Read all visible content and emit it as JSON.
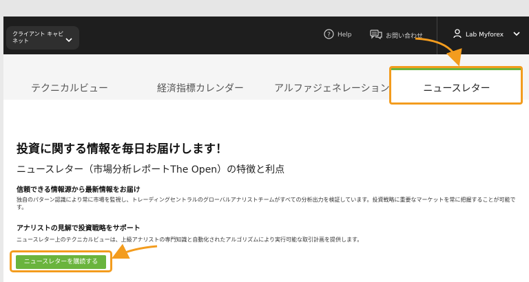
{
  "header": {
    "cabinet_label": "クライアント キャビネット",
    "help_label": "Help",
    "contact_label": "お問い合わせ",
    "user_label": "Lab Myforex"
  },
  "tabs": [
    {
      "label": "テクニカルビュー"
    },
    {
      "label": "経済指標カレンダー"
    },
    {
      "label": "アルファジェネレーション"
    },
    {
      "label": "ニュースレター"
    }
  ],
  "content": {
    "title": "投資に関する情報を毎日お届けします！",
    "subtitle": "ニュースレター（市場分析レポートThe Open）の特徴と利点",
    "section1_heading": "信頼できる情報源から最新情報をお届け",
    "section1_text": "独自のパターン認識により常に市場を監視し、トレーディングセントラルのグローバルアナリストチームがすべての分析出力を検証しています。投資戦略に重要なマーケットを常に把握することが可能です。",
    "section2_heading": "アナリストの見解で投資戦略をサポート",
    "section2_text": "ニュースレター上のテクニカルビューは、上級アナリストの専門知識と自動化されたアルゴリズムにより実行可能な取引計画を提供します。",
    "subscribe_label": "ニュースレターを購読する"
  },
  "colors": {
    "accent_green": "#6ab43d",
    "highlight_orange": "#f39c1e",
    "topbar": "#1e1e1e"
  }
}
